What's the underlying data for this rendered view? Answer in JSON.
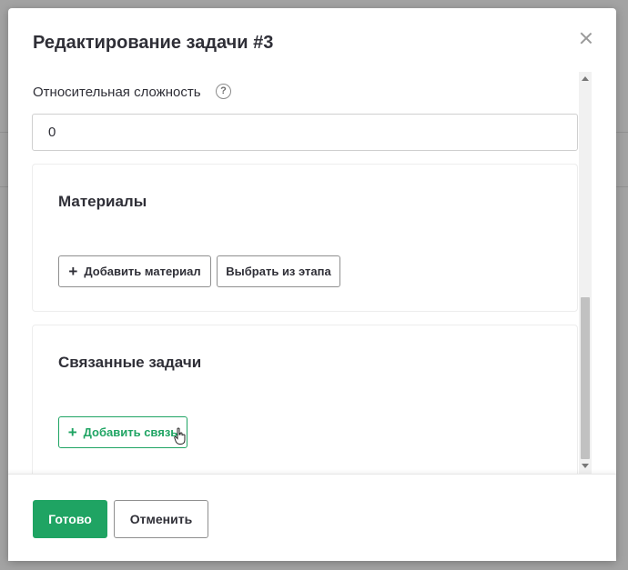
{
  "modal": {
    "title": "Редактирование задачи #3",
    "close_icon": "close-icon"
  },
  "complexity": {
    "label": "Относительная сложность",
    "help_icon": "help-icon",
    "help_glyph": "?",
    "value": "0"
  },
  "materials": {
    "title": "Материалы",
    "add_label": "Добавить материал",
    "choose_label": "Выбрать из этапа"
  },
  "linked_tasks": {
    "title": "Связанные задачи",
    "add_label": "Добавить связь"
  },
  "footer": {
    "done_label": "Готово",
    "cancel_label": "Отменить"
  },
  "colors": {
    "accent": "#1fa463",
    "text": "#2f2f37",
    "overlay": "#a3a3a3"
  },
  "plus_glyph": "+"
}
